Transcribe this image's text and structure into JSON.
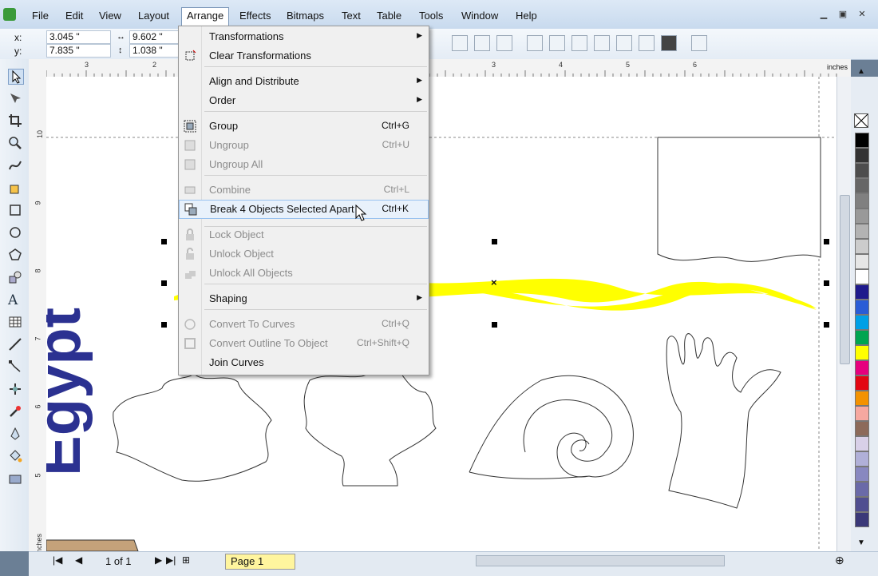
{
  "menubar": {
    "items": [
      "File",
      "Edit",
      "View",
      "Layout",
      "Arrange",
      "Effects",
      "Bitmaps",
      "Text",
      "Table",
      "Tools",
      "Window",
      "Help"
    ]
  },
  "propbar": {
    "x_label": "x:",
    "x": "3.045 \"",
    "y_label": "y:",
    "y": "7.835 \"",
    "w": "9.602 \"",
    "h": "1.038 \""
  },
  "ruler": {
    "h_ticks": [
      "3",
      "2",
      "3",
      "4",
      "5",
      "6"
    ],
    "v_ticks": [
      "10",
      "9",
      "8",
      "7",
      "6",
      "5"
    ],
    "units": "inches",
    "v_units": "inches"
  },
  "dropdown": {
    "items": [
      {
        "label": "Transformations",
        "shortcut": "",
        "submenu": true,
        "disabled": false
      },
      {
        "label": "Clear Transformations",
        "shortcut": "",
        "submenu": false,
        "disabled": false
      },
      {
        "label": "Align and Distribute",
        "shortcut": "",
        "submenu": true,
        "disabled": false
      },
      {
        "label": "Order",
        "shortcut": "",
        "submenu": true,
        "disabled": false
      },
      {
        "label": "Group",
        "shortcut": "Ctrl+G",
        "submenu": false,
        "disabled": false
      },
      {
        "label": "Ungroup",
        "shortcut": "Ctrl+U",
        "submenu": false,
        "disabled": true
      },
      {
        "label": "Ungroup All",
        "shortcut": "",
        "submenu": false,
        "disabled": true
      },
      {
        "label": "Combine",
        "shortcut": "Ctrl+L",
        "submenu": false,
        "disabled": true
      },
      {
        "label": "Break 4 Objects Selected Apart",
        "shortcut": "Ctrl+K",
        "submenu": false,
        "disabled": false
      },
      {
        "label": "Lock Object",
        "shortcut": "",
        "submenu": false,
        "disabled": true
      },
      {
        "label": "Unlock Object",
        "shortcut": "",
        "submenu": false,
        "disabled": true
      },
      {
        "label": "Unlock All Objects",
        "shortcut": "",
        "submenu": false,
        "disabled": true
      },
      {
        "label": "Shaping",
        "shortcut": "",
        "submenu": true,
        "disabled": false
      },
      {
        "label": "Convert To Curves",
        "shortcut": "Ctrl+Q",
        "submenu": false,
        "disabled": true
      },
      {
        "label": "Convert Outline To Object",
        "shortcut": "Ctrl+Shift+Q",
        "submenu": false,
        "disabled": true
      },
      {
        "label": "Join Curves",
        "shortcut": "",
        "submenu": false,
        "disabled": false
      }
    ]
  },
  "canvas": {
    "text": "Egypt",
    "text_color": "#2b3191",
    "ribbon_color": "#ffff00"
  },
  "bottombar": {
    "page_count": "1 of 1",
    "page_tab": "Page 1"
  },
  "palette": {
    "colors": [
      "#000000",
      "#333333",
      "#4d4d4d",
      "#666666",
      "#808080",
      "#999999",
      "#b3b3b3",
      "#cccccc",
      "#e6e6e6",
      "#ffffff",
      "#1f1a8c",
      "#2a5cd6",
      "#00a0e6",
      "#00a550",
      "#ffff00",
      "#e6007e",
      "#e30613",
      "#f39200",
      "#f6a8a0",
      "#8c6a5a",
      "#d8d0e8",
      "#b0b0d8",
      "#8888c0",
      "#6a6aa8",
      "#504e90",
      "#3a3878"
    ]
  }
}
